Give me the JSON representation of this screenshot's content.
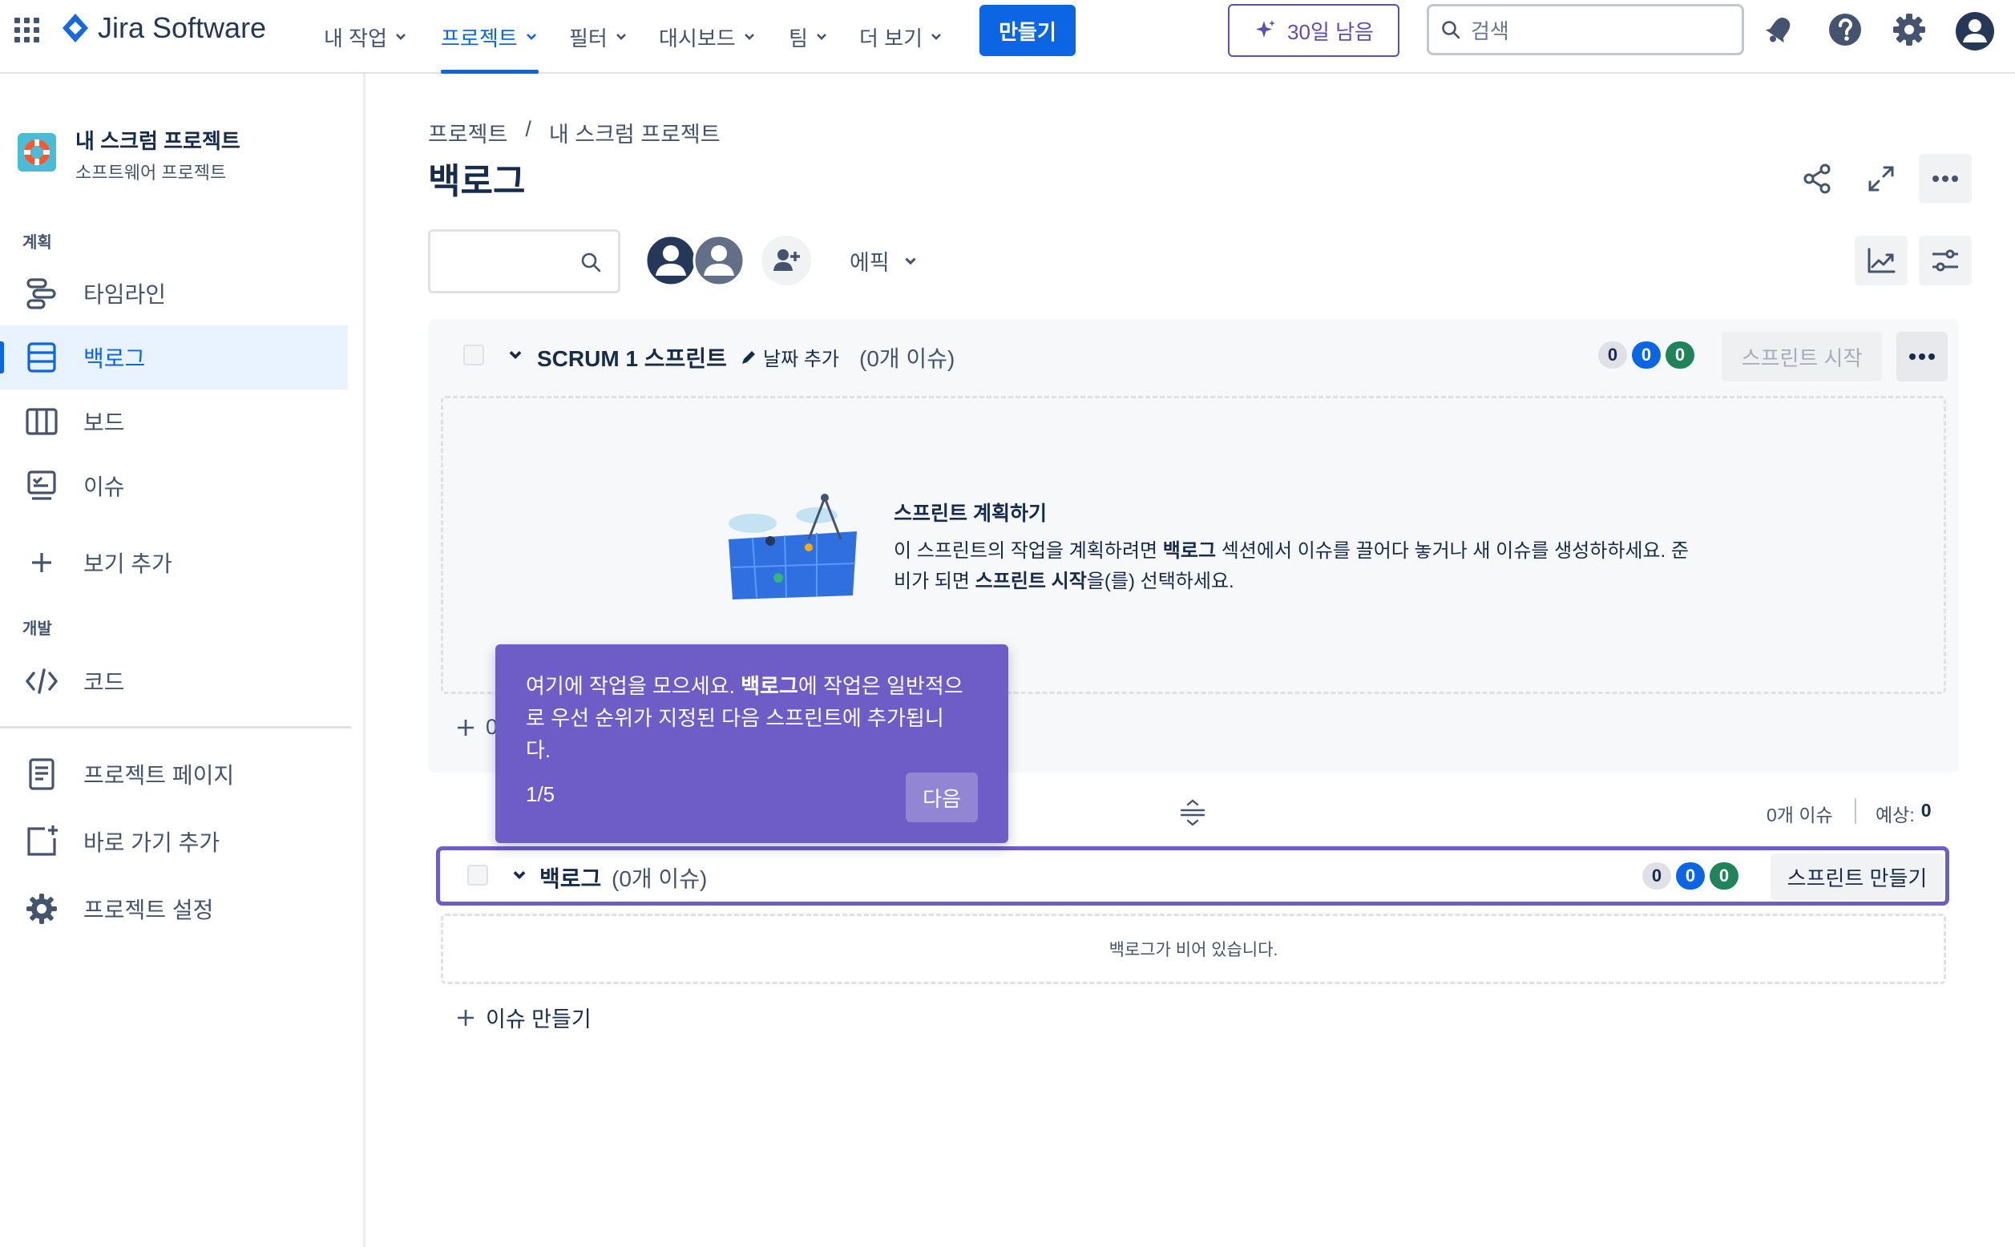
{
  "app": {
    "name": "Jira Software"
  },
  "topnav": {
    "items": [
      {
        "label": "내 작업"
      },
      {
        "label": "프로젝트"
      },
      {
        "label": "필터"
      },
      {
        "label": "대시보드"
      },
      {
        "label": "팀"
      },
      {
        "label": "더 보기"
      }
    ],
    "active": "프로젝트",
    "create_label": "만들기",
    "trial_label": "30일 남음",
    "search_placeholder": "검색"
  },
  "sidebar": {
    "project_name": "내 스크럼 프로젝트",
    "project_type": "소프트웨어 프로젝트",
    "section_plan": "계획",
    "section_dev": "개발",
    "items": [
      {
        "label": "타임라인",
        "icon": "timeline-icon"
      },
      {
        "label": "백로그",
        "icon": "backlog-icon",
        "active": true
      },
      {
        "label": "보드",
        "icon": "board-icon"
      },
      {
        "label": "이슈",
        "icon": "issues-icon"
      },
      {
        "label": "보기 추가",
        "icon": "plus-icon"
      },
      {
        "label": "코드",
        "icon": "code-icon"
      },
      {
        "label": "프로젝트 페이지",
        "icon": "page-icon"
      },
      {
        "label": "바로 가기 추가",
        "icon": "add-shortcut-icon"
      },
      {
        "label": "프로젝트 설정",
        "icon": "settings-icon"
      }
    ]
  },
  "main": {
    "breadcrumb": [
      "프로젝트",
      "/",
      "내 스크럼 프로젝트"
    ],
    "title": "백로그",
    "epic_filter": "에픽",
    "sprint": {
      "name": "SCRUM 1 스프린트",
      "add_dates": "날짜 추가",
      "issue_count": "(0개 이슈)",
      "counts": [
        "0",
        "0",
        "0"
      ],
      "start_label": "스프린트 시작",
      "empty_title": "스프린트 계획하기",
      "empty_line1_a": "이 스프린트의 작업을 계획하려면 ",
      "empty_line1_b": "백로그",
      "empty_line1_c": " 섹션에서 이슈를 끌어다 놓거나 새 이슈를 생성하하세요. 준",
      "empty_line2_a": "비가 되면 ",
      "empty_line2_b": "스프린트 시작",
      "empty_line2_c": "을(를) 선택하세요.",
      "create_issue_partial": "0"
    },
    "summary": {
      "issues": "0개 이슈",
      "estimate_label": "예상:",
      "estimate_value": "0"
    },
    "backlog": {
      "name": "백로그",
      "issue_count": "(0개 이슈)",
      "counts": [
        "0",
        "0",
        "0"
      ],
      "create_sprint": "스프린트 만들기",
      "empty_text": "백로그가 비어 있습니다.",
      "create_issue": "이슈 만들기"
    }
  },
  "tooltip": {
    "text_a": "여기에 작업을 모으세요. ",
    "text_b": "백로그",
    "text_c": "에 작업은 일반적으",
    "text_line2": "로 우선 순위가 지정된 다음 스프린트에 추가됩니",
    "text_line3": "다.",
    "step": "1/5",
    "next_label": "다음"
  },
  "colors": {
    "brand": "#0c66e4",
    "discovery": "#6e5dc6",
    "success": "#1f845a"
  }
}
